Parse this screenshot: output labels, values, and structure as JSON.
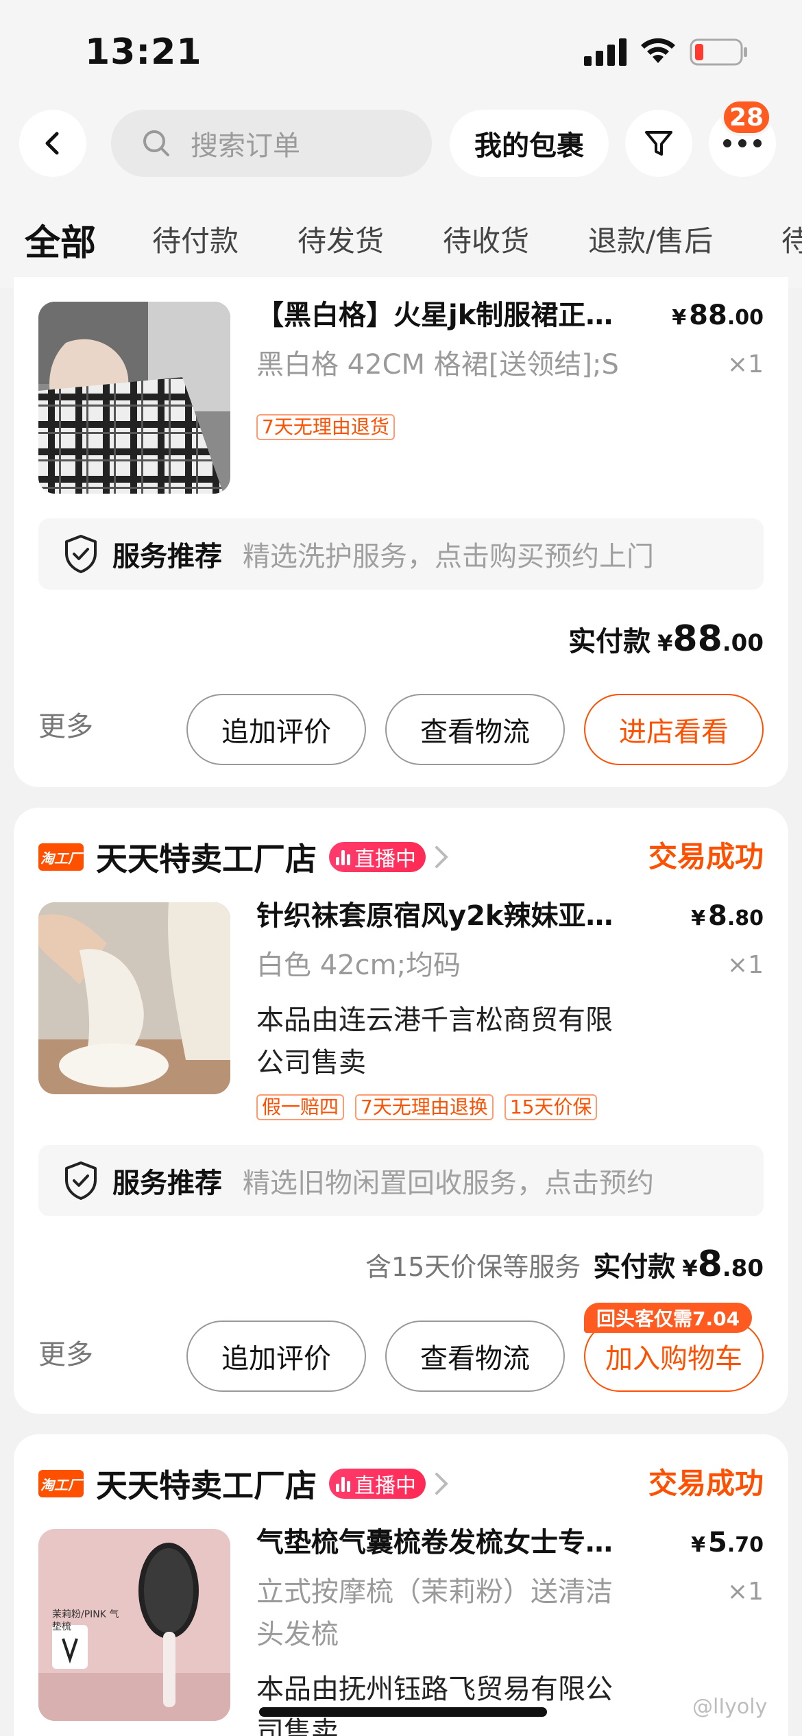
{
  "status_bar": {
    "time": "13:21"
  },
  "header": {
    "search_placeholder": "搜索订单",
    "packages_label": "我的包裹",
    "notification_count": "28"
  },
  "tabs": [
    "全部",
    "待付款",
    "待发货",
    "待收货",
    "退款/售后",
    "待"
  ],
  "orders": [
    {
      "title": "【黑白格】火星jk制服裙正…",
      "price_int": "88",
      "price_dec": ".00",
      "currency": "¥",
      "sku": "黑白格 42CM 格裙[送领结];S",
      "qty": "×1",
      "tags": [
        "7天无理由退货"
      ],
      "service_label": "服务推荐",
      "service_desc": "精选洗护服务，点击购买预约上门",
      "paid_label": "实付款",
      "paid_int": "88",
      "paid_dec": ".00",
      "more": "更多",
      "buttons": [
        "追加评价",
        "查看物流",
        "进店看看"
      ]
    },
    {
      "store_logo": "淘工厂",
      "store": "天天特卖工厂店",
      "live": "直播中",
      "status": "交易成功",
      "title": "针织袜套原宿风y2k辣妹亚…",
      "price_int": "8",
      "price_dec": ".80",
      "currency": "¥",
      "sku": "白色 42cm;均码",
      "qty": "×1",
      "seller_line1": "本品由连云港千言松商贸有限",
      "seller_line2": "公司售卖",
      "tags": [
        "假一赔四",
        "7天无理由退换",
        "15天价保"
      ],
      "service_label": "服务推荐",
      "service_desc": "精选旧物闲置回收服务，点击预约",
      "paid_note": "含15天价保等服务",
      "paid_label": "实付款",
      "paid_int": "8",
      "paid_dec": ".80",
      "more": "更多",
      "promo": "回头客仅需7.04",
      "buttons": [
        "追加评价",
        "查看物流",
        "加入购物车"
      ]
    },
    {
      "store_logo": "淘工厂",
      "store": "天天特卖工厂店",
      "live": "直播中",
      "status": "交易成功",
      "title": "气垫梳气囊梳卷发梳女士专…",
      "price_int": "5",
      "price_dec": ".70",
      "currency": "¥",
      "sku_line1": "立式按摩梳（茉莉粉）送清洁",
      "sku_line2": "头发梳",
      "qty": "×1",
      "seller_line1": "本品由抚州钰路飞贸易有限公",
      "seller_line2": "司售卖",
      "thumb_text": "茉莉粉/PINK 气垫梳"
    }
  ],
  "watermark": "@lIyoly",
  "colors": {
    "accent": "#ff5000",
    "background": "#f2f2f2"
  }
}
